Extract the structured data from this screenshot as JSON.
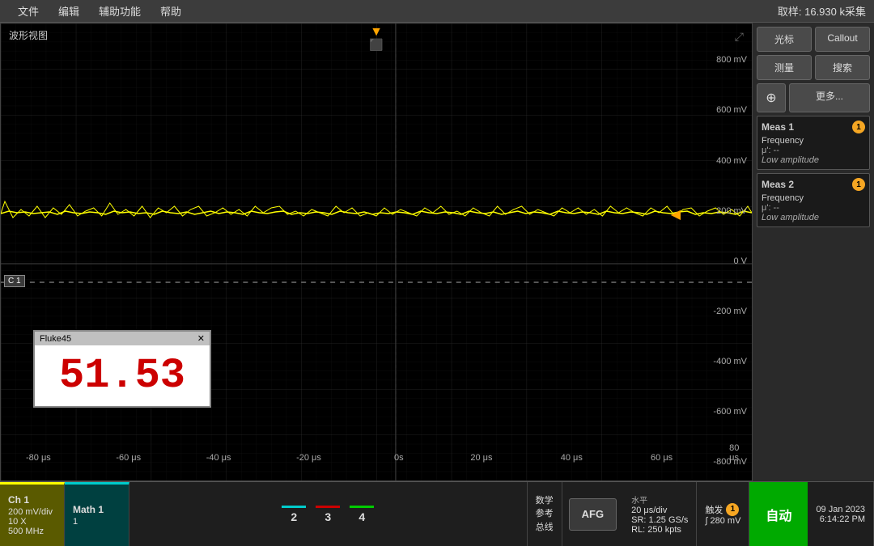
{
  "menubar": {
    "items": [
      "文件",
      "编辑",
      "辅助功能",
      "帮助"
    ],
    "sample_rate": "取样: 16.930 k采集"
  },
  "waveform": {
    "title": "波形视图",
    "y_labels": [
      {
        "value": "800 mV",
        "pct": 8
      },
      {
        "value": "600 mV",
        "pct": 19
      },
      {
        "value": "400 mV",
        "pct": 30
      },
      {
        "value": "200 mV",
        "pct": 41
      },
      {
        "value": "0 V",
        "pct": 52
      },
      {
        "value": "-200 mV",
        "pct": 63
      },
      {
        "value": "-400 mV",
        "pct": 74
      },
      {
        "value": "-600 mV",
        "pct": 85
      },
      {
        "value": "-800 mV",
        "pct": 96
      }
    ],
    "x_labels": [
      {
        "value": "-80 μs",
        "pct": 5
      },
      {
        "value": "-60 μs",
        "pct": 17
      },
      {
        "value": "-40 μs",
        "pct": 29
      },
      {
        "value": "-20 μs",
        "pct": 41
      },
      {
        "value": "0s",
        "pct": 53
      },
      {
        "value": "20 μs",
        "pct": 64
      },
      {
        "value": "40 μs",
        "pct": 76
      },
      {
        "value": "60 μs",
        "pct": 88
      },
      {
        "value": "80 μs",
        "pct": 98
      }
    ]
  },
  "fluke": {
    "title": "Fluke45",
    "value": "51.53",
    "close": "✕"
  },
  "right_panel": {
    "btn_cursor": "光标",
    "btn_callout": "Callout",
    "btn_measure": "测量",
    "btn_search": "搜索",
    "btn_zoom_icon": "⊕",
    "btn_more": "更多...",
    "meas1": {
      "title": "Meas 1",
      "badge": "1",
      "param1": "Frequency",
      "param1_val": "μ': --",
      "note": "Low amplitude"
    },
    "meas2": {
      "title": "Meas 2",
      "badge": "1",
      "param1": "Frequency",
      "param1_val": "μ': --",
      "note": "Low amplitude"
    }
  },
  "bottom": {
    "ch1_label": "Ch 1",
    "ch1_line1": "200 mV/div",
    "ch1_line2": "10 X",
    "ch1_line3": "500 MHz",
    "math_label": "Math 1",
    "math_line1": "1",
    "ch2_color": "cyan",
    "ch3_color": "red",
    "ch4_color": "green",
    "ch2_num": "2",
    "ch3_num": "3",
    "ch4_num": "4",
    "math_ref_total": "数学\n参考\n总线",
    "afg_label": "AFG",
    "horiz_title": "水平",
    "horiz_line1": "20 μs/div",
    "horiz_line2": "SR: 1.25 GS/s",
    "horiz_line3": "RL: 250 kpts",
    "trigger_title": "触发",
    "trigger_badge": "1",
    "trigger_level": "∫ 280 mV",
    "auto_label": "自动",
    "date": "09 Jan 2023",
    "time": "6:14:22 PM"
  }
}
